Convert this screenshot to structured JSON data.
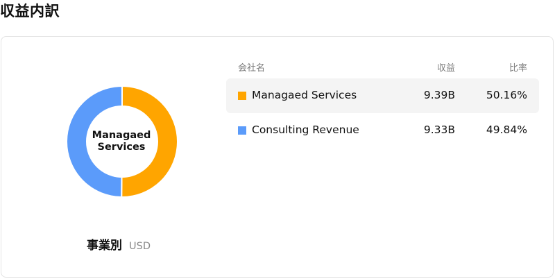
{
  "page_title": "収益内訳",
  "donut": {
    "center_label_line1": "Managaed",
    "center_label_line2": "Services",
    "caption_title": "事業別",
    "caption_unit": "USD"
  },
  "table": {
    "headers": {
      "company": "会社名",
      "revenue": "収益",
      "ratio": "比率"
    },
    "rows": [
      {
        "name": "Managaed Services",
        "revenue": "9.39B",
        "ratio": "50.16%",
        "color": "#FFA500",
        "fraction": 0.5016
      },
      {
        "name": "Consulting Revenue",
        "revenue": "9.33B",
        "ratio": "49.84%",
        "color": "#5B9BFA",
        "fraction": 0.4984
      }
    ]
  },
  "chart_data": {
    "type": "pie",
    "categories": [
      "Managaed Services",
      "Consulting Revenue"
    ],
    "values": [
      9.39,
      9.33
    ],
    "percent": [
      50.16,
      49.84
    ],
    "colors": [
      "#FFA500",
      "#5B9BFA"
    ],
    "title": "",
    "legend": "table-right"
  }
}
